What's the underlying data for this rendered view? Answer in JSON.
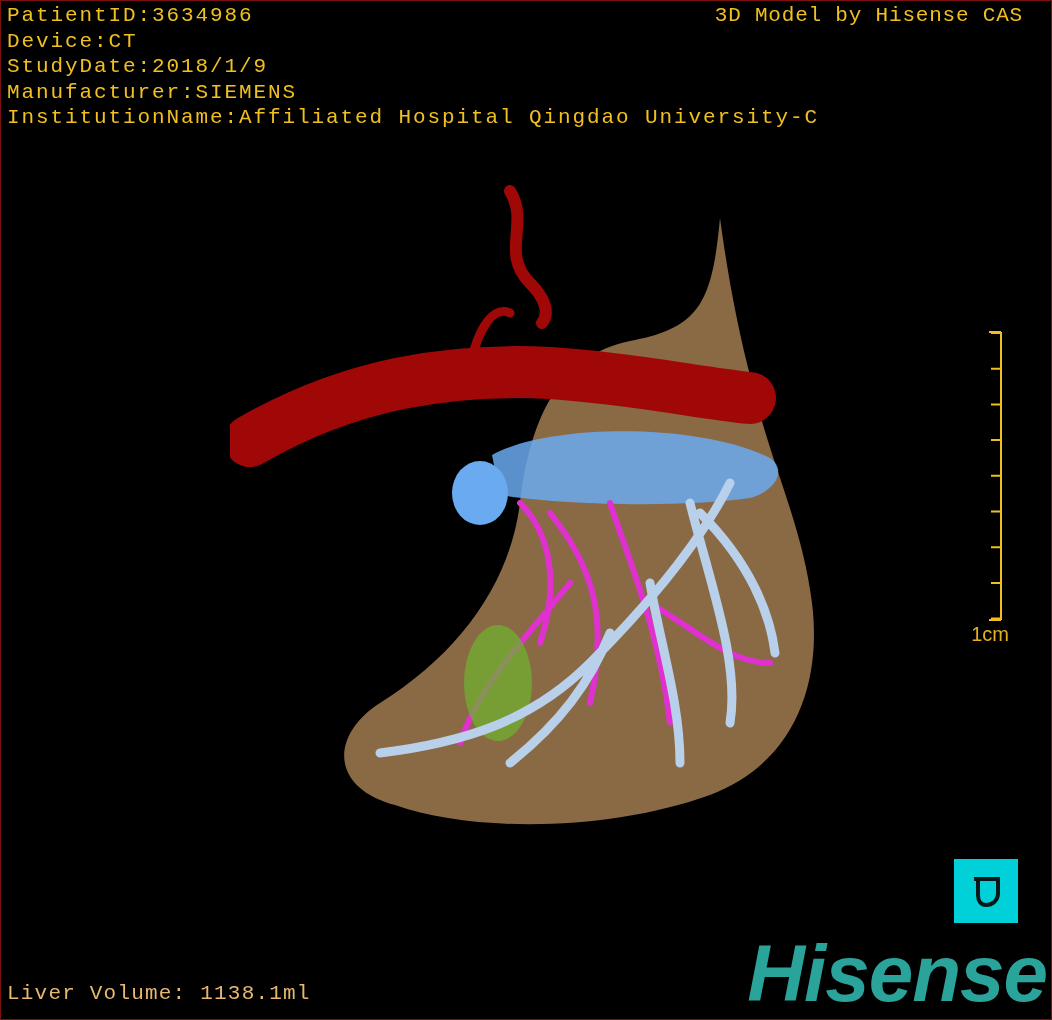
{
  "header": {
    "info_lines": [
      "PatientID:3634986",
      "Device:CT",
      "StudyDate:2018/1/9",
      "Manufacturer:SIEMENS",
      "InstitutionName:Affiliated Hospital Qingdao University-C"
    ],
    "title": "3D Model by Hisense CAS"
  },
  "scale_bar": {
    "label": "1cm"
  },
  "footer": {
    "liver_volume": "Liver Volume: 1138.1ml",
    "brand": "Hisense"
  }
}
